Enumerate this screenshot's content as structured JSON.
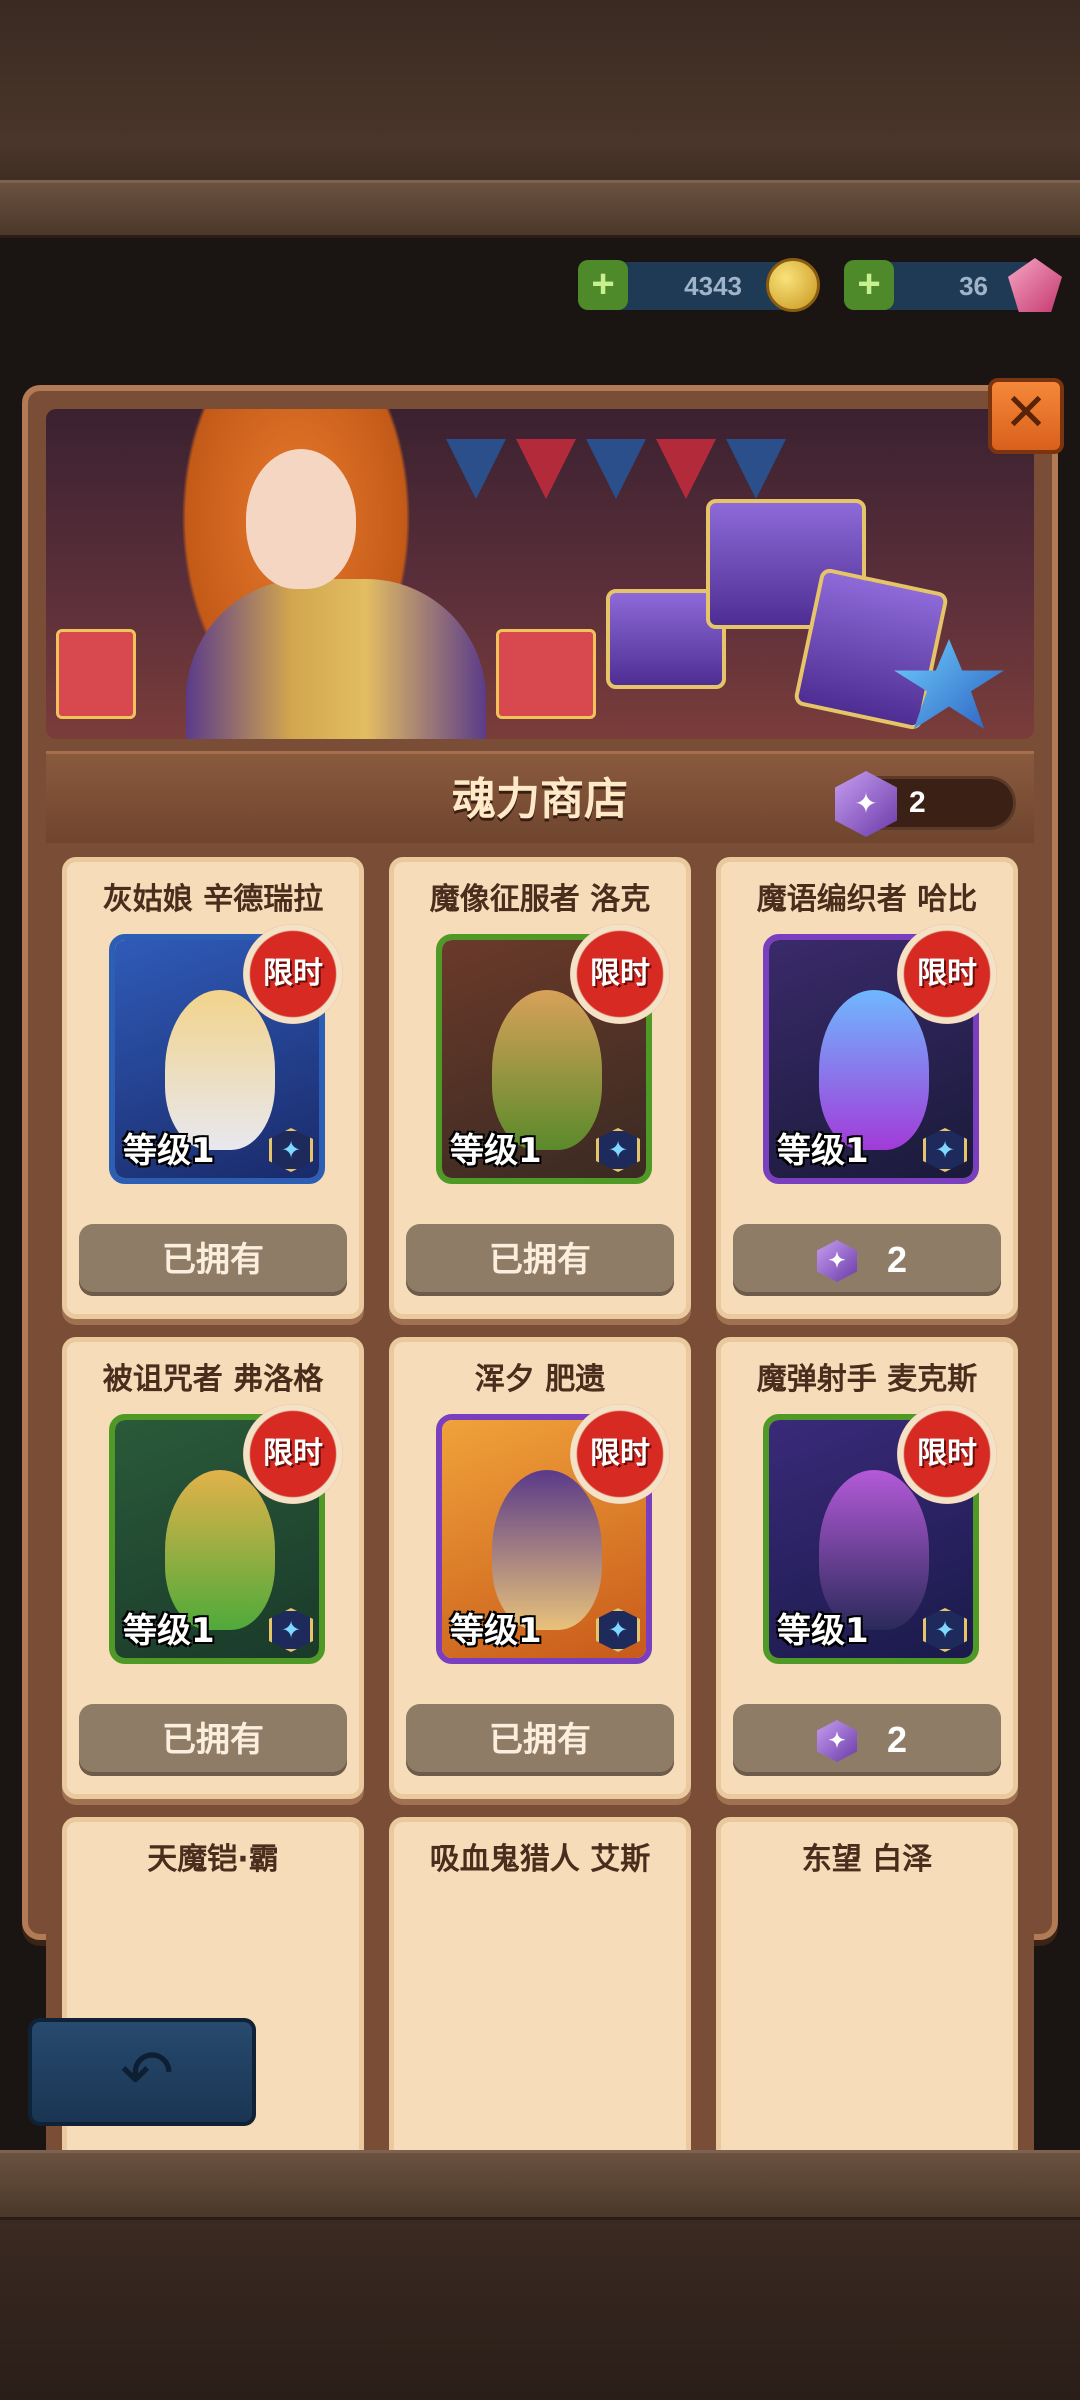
{
  "currencies": {
    "gold": "4343",
    "gems": "36"
  },
  "shop": {
    "title": "魂力商店",
    "soul_balance": "2"
  },
  "cards": [
    {
      "name": "灰姑娘 辛德瑞拉",
      "level": "等级1",
      "tag": "限时",
      "status": "已拥有",
      "frame": "blue"
    },
    {
      "name": "魔像征服者 洛克",
      "level": "等级1",
      "tag": "限时",
      "status": "已拥有",
      "frame": "green"
    },
    {
      "name": "魔语编织者 哈比",
      "level": "等级1",
      "tag": "限时",
      "price": "2",
      "frame": "purple"
    },
    {
      "name": "被诅咒者 弗洛格",
      "level": "等级1",
      "tag": "限时",
      "status": "已拥有",
      "frame": "green"
    },
    {
      "name": "浑夕 肥遗",
      "level": "等级1",
      "tag": "限时",
      "status": "已拥有",
      "frame": "purple"
    },
    {
      "name": "魔弹射手 麦克斯",
      "level": "等级1",
      "tag": "限时",
      "price": "2",
      "frame": "green"
    },
    {
      "name": "天魔铠·霸"
    },
    {
      "name": "吸血鬼猎人 艾斯"
    },
    {
      "name": "东望 白泽"
    }
  ],
  "colors": {
    "card_bg": "#f6dcb8",
    "limited_red": "#d62a22",
    "panel_wood": "#7a4e36",
    "button_gray": "#8f7c66"
  },
  "icons": {
    "close": "close-icon",
    "back": "back-arrow-icon",
    "soul": "soul-crystal-icon",
    "gold": "gold-coin-icon",
    "gem": "gem-icon",
    "star": "star-badge-icon"
  }
}
